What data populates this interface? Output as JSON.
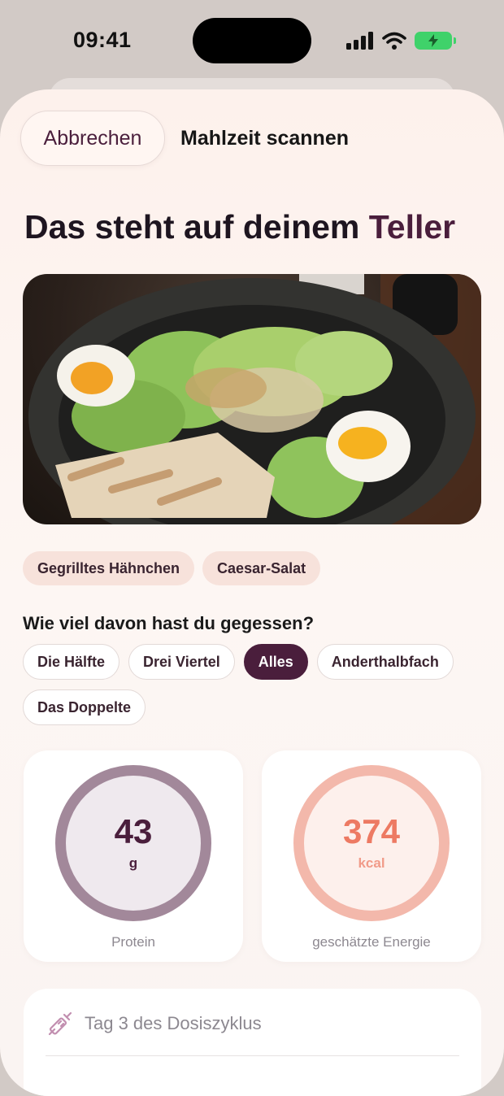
{
  "status_bar": {
    "time": "09:41"
  },
  "header": {
    "cancel_label": "Abbrechen",
    "title": "Mahlzeit scannen"
  },
  "headline": {
    "text": "Das steht auf deinem",
    "accent": "Teller"
  },
  "detected_foods": [
    "Gegrilltes Hähnchen",
    "Caesar-Salat"
  ],
  "portion": {
    "question": "Wie viel davon hast du gegessen?",
    "options": [
      "Die Hälfte",
      "Drei Viertel",
      "Alles",
      "Anderthalbfach",
      "Das Doppelte"
    ],
    "selected": "Alles"
  },
  "stats": {
    "protein": {
      "value": "43",
      "unit": "g",
      "label": "Protein"
    },
    "energy": {
      "value": "374",
      "unit": "kcal",
      "label": "geschätzte Energie"
    }
  },
  "dose": {
    "text": "Tag 3 des Dosiszyklus"
  },
  "colors": {
    "accent": "#4a1e3c",
    "energy": "#ed7a63",
    "protein_ring": "#a2889a",
    "energy_ring": "#f3b8ab"
  },
  "icons": [
    "cellular-icon",
    "wifi-icon",
    "battery-charging-icon",
    "syringe-icon"
  ]
}
